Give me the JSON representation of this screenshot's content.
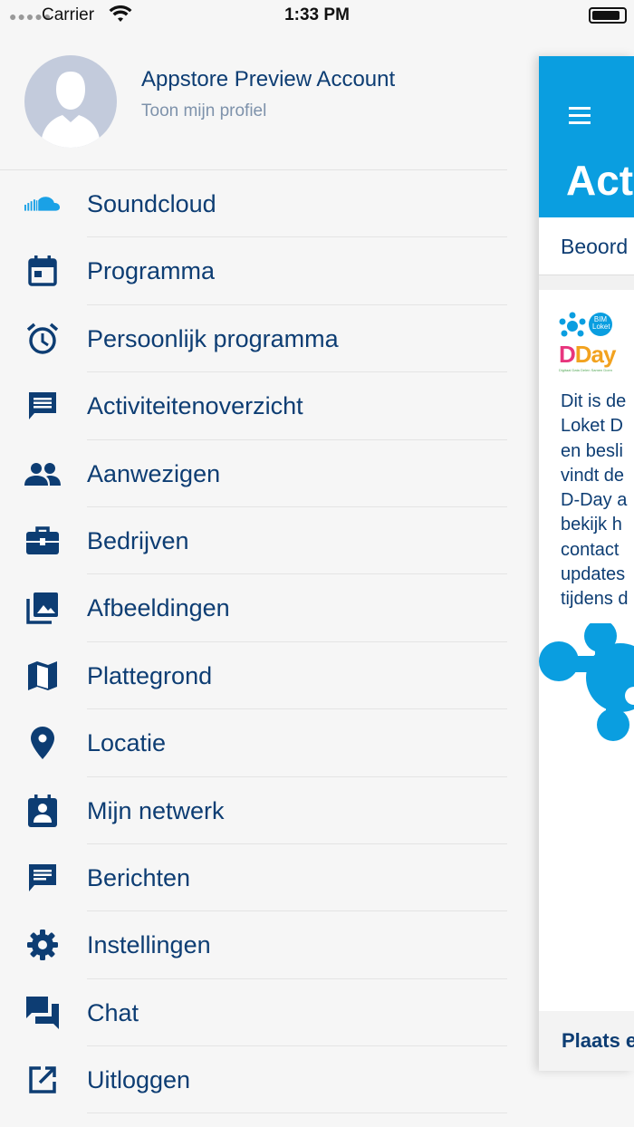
{
  "status_bar": {
    "carrier": "Carrier",
    "time": "1:33 PM"
  },
  "profile": {
    "name": "Appstore Preview Account",
    "link": "Toon mijn profiel"
  },
  "menu": [
    {
      "label": "Soundcloud",
      "icon": "soundcloud-icon"
    },
    {
      "label": "Programma",
      "icon": "calendar-icon"
    },
    {
      "label": "Persoonlijk programma",
      "icon": "alarm-clock-icon"
    },
    {
      "label": "Activiteitenoverzicht",
      "icon": "comment-icon"
    },
    {
      "label": "Aanwezigen",
      "icon": "people-icon"
    },
    {
      "label": "Bedrijven",
      "icon": "briefcase-icon"
    },
    {
      "label": "Afbeeldingen",
      "icon": "image-library-icon"
    },
    {
      "label": "Plattegrond",
      "icon": "map-icon"
    },
    {
      "label": "Locatie",
      "icon": "location-pin-icon"
    },
    {
      "label": "Mijn netwerk",
      "icon": "contact-badge-icon"
    },
    {
      "label": "Berichten",
      "icon": "message-icon"
    },
    {
      "label": "Instellingen",
      "icon": "gear-icon"
    },
    {
      "label": "Chat",
      "icon": "chat-icon"
    },
    {
      "label": "Uitloggen",
      "icon": "logout-icon"
    }
  ],
  "main": {
    "title": "Act",
    "tab": "Beoord",
    "logo": {
      "badge": "BIM Loket",
      "text_d": "D",
      "text_rest": "Day",
      "tagline": "Digitaal Data Delen Samen Doen"
    },
    "description_lines": [
      "Dit is de",
      "Loket D",
      "en besli",
      "vindt de",
      "D-Day a",
      "bekijk h",
      "contact",
      "updates",
      "tijdens d"
    ],
    "footer": "Plaats e"
  },
  "colors": {
    "primary_blue": "#0a9ee0",
    "navy_text": "#0d3d73",
    "muted": "#7e92ab"
  }
}
